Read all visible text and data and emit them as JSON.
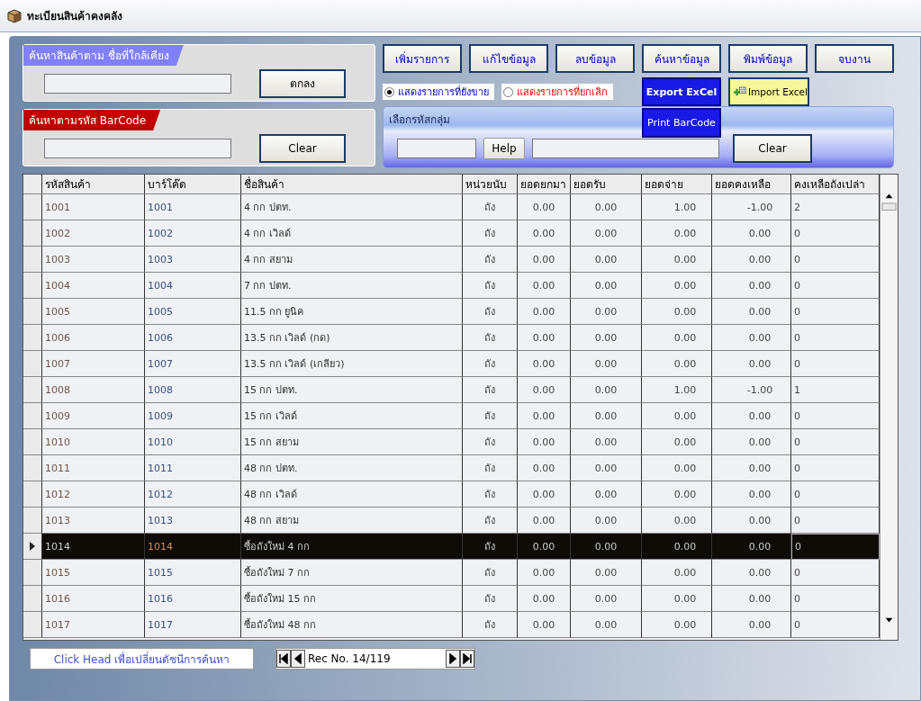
{
  "window": {
    "title": "ทะเบียนสินค้าคงคลัง"
  },
  "name_search": {
    "label": "ค้นหาสินค้าตาม ชื่อที่ใกล้เคียง",
    "button": "ตกลง"
  },
  "barcode_search": {
    "label": "ค้นหาตามรหัส BarCode",
    "button": "Clear"
  },
  "actions": [
    "เพิ่มรายการ",
    "แก้ไขข้อมูล",
    "ลบข้อมูล",
    "ค้นหาข้อมูล",
    "พิมพ์ข้อมูล",
    "จบงาน"
  ],
  "options": [
    {
      "label": "แสดงรายการที่ยังขาย",
      "selected": true
    },
    {
      "label": "แสดงรายการที่ยกเลิก",
      "selected": false
    }
  ],
  "export_button": "Export ExCel",
  "import_button": "Import Excel",
  "print_barcode_button": "Print BarCode",
  "group_panel": {
    "label": "เลือกรหัสกลุ่ม",
    "help_button": "Help",
    "clear_button": "Clear"
  },
  "table": {
    "columns": [
      "รหัสสินค้า",
      "บาร์โค๊ด",
      "ชื่อสินค้า",
      "หน่วยนับ",
      "ยอดยกมา",
      "ยอดรับ",
      "ยอดจ่าย",
      "ยอดคงเหลือ",
      "คงเหลือถังเปล่า"
    ],
    "rows": [
      {
        "selected": false,
        "cells": [
          "1001",
          "1001",
          "4 กก ปตท.",
          "ถัง",
          "0.00",
          "0.00",
          "1.00",
          "-1.00",
          "2"
        ]
      },
      {
        "selected": false,
        "cells": [
          "1002",
          "1002",
          "4 กก เวิลด์",
          "ถัง",
          "0.00",
          "0.00",
          "0.00",
          "0.00",
          "0"
        ]
      },
      {
        "selected": false,
        "cells": [
          "1003",
          "1003",
          "4 กก สยาม",
          "ถัง",
          "0.00",
          "0.00",
          "0.00",
          "0.00",
          "0"
        ]
      },
      {
        "selected": false,
        "cells": [
          "1004",
          "1004",
          "7 กก ปตท.",
          "ถัง",
          "0.00",
          "0.00",
          "0.00",
          "0.00",
          "0"
        ]
      },
      {
        "selected": false,
        "cells": [
          "1005",
          "1005",
          "11.5 กก ยูนิค",
          "ถัง",
          "0.00",
          "0.00",
          "0.00",
          "0.00",
          "0"
        ]
      },
      {
        "selected": false,
        "cells": [
          "1006",
          "1006",
          "13.5 กก เวิลด์ (กด)",
          "ถัง",
          "0.00",
          "0.00",
          "0.00",
          "0.00",
          "0"
        ]
      },
      {
        "selected": false,
        "cells": [
          "1007",
          "1007",
          "13.5 กก เวิลด์ (เกลียว)",
          "ถัง",
          "0.00",
          "0.00",
          "0.00",
          "0.00",
          "0"
        ]
      },
      {
        "selected": false,
        "cells": [
          "1008",
          "1008",
          "15 กก ปตท.",
          "ถัง",
          "0.00",
          "0.00",
          "1.00",
          "-1.00",
          "1"
        ]
      },
      {
        "selected": false,
        "cells": [
          "1009",
          "1009",
          "15 กก เวิลด์",
          "ถัง",
          "0.00",
          "0.00",
          "0.00",
          "0.00",
          "0"
        ]
      },
      {
        "selected": false,
        "cells": [
          "1010",
          "1010",
          "15 กก สยาม",
          "ถัง",
          "0.00",
          "0.00",
          "0.00",
          "0.00",
          "0"
        ]
      },
      {
        "selected": false,
        "cells": [
          "1011",
          "1011",
          "48 กก ปตท.",
          "ถัง",
          "0.00",
          "0.00",
          "0.00",
          "0.00",
          "0"
        ]
      },
      {
        "selected": false,
        "cells": [
          "1012",
          "1012",
          "48 กก เวิลด์",
          "ถัง",
          "0.00",
          "0.00",
          "0.00",
          "0.00",
          "0"
        ]
      },
      {
        "selected": false,
        "cells": [
          "1013",
          "1013",
          "48 กก สยาม",
          "ถัง",
          "0.00",
          "0.00",
          "0.00",
          "0.00",
          "0"
        ]
      },
      {
        "selected": true,
        "cells": [
          "1014",
          "1014",
          "ซื้อถังใหม่ 4 กก",
          "ถัง",
          "0.00",
          "0.00",
          "0.00",
          "0.00",
          "0"
        ]
      },
      {
        "selected": false,
        "cells": [
          "1015",
          "1015",
          "ซื้อถังใหม่ 7 กก",
          "ถัง",
          "0.00",
          "0.00",
          "0.00",
          "0.00",
          "0"
        ]
      },
      {
        "selected": false,
        "cells": [
          "1016",
          "1016",
          "ซื้อถังใหม่ 15 กก",
          "ถัง",
          "0.00",
          "0.00",
          "0.00",
          "0.00",
          "0"
        ]
      },
      {
        "selected": false,
        "cells": [
          "1017",
          "1017",
          "ซื้อถังใหม่ 48 กก",
          "ถัง",
          "0.00",
          "0.00",
          "0.00",
          "0.00",
          "0"
        ]
      }
    ]
  },
  "footer_hint": "Click Head เพื่อเปลี่ยนดัชนีการค้นหา",
  "navigator": {
    "record": "Rec No. 14/119"
  }
}
